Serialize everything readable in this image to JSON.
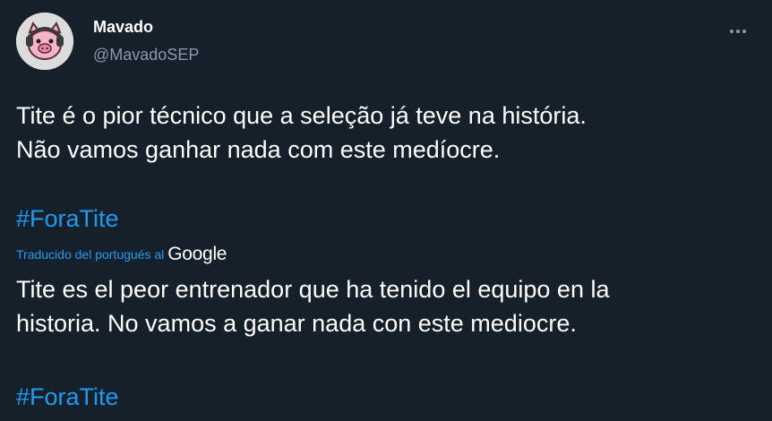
{
  "author": {
    "name": "Mavado",
    "handle": "@MavadoSEP"
  },
  "tweet": {
    "original_text": "Tite é o pior técnico que a seleção já teve na história.\nNão vamos ganhar nada com este medíocre.",
    "original_hashtag": "#ForaTite",
    "translated_label": "Traducido del portugués al",
    "translator_logo": "Google",
    "translated_text": "Tite es el peor entrenador que ha tenido el equipo en la\nhistoria. No vamos a ganar nada con este mediocre.",
    "translated_hashtag": "#ForaTite"
  },
  "icons": {
    "more": "more-horizontal-icon",
    "avatar": "pig-avatar"
  },
  "colors": {
    "background": "#15202b",
    "text": "#ffffff",
    "secondary": "#8b98a5",
    "accent": "#1d9bf0"
  }
}
